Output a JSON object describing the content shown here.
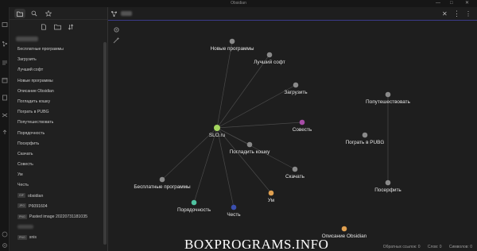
{
  "window": {
    "title": "Obsidian",
    "minimize_glyph": "—",
    "maximize_glyph": "□",
    "close_glyph": "✕"
  },
  "ribbon": {
    "icons": [
      "open-vault-icon",
      "graph-icon",
      "command-icon",
      "daily-note-icon",
      "template-icon",
      "random-note-icon",
      "publish-icon"
    ]
  },
  "sidebar": {
    "tabs": [
      "file-explorer-icon",
      "search-icon",
      "star-icon"
    ],
    "actions": [
      "new-note-icon",
      "new-folder-icon",
      "sort-icon"
    ],
    "files": [
      {
        "label": "Бесплатные программы"
      },
      {
        "label": "Загрузить"
      },
      {
        "label": "Лучший софт"
      },
      {
        "label": "Новые программы"
      },
      {
        "label": "Описание Obsidian"
      },
      {
        "label": "Погладить кошку"
      },
      {
        "label": "Пограть в PUBG"
      },
      {
        "label": "Попутешествовать"
      },
      {
        "label": "Порядочность"
      },
      {
        "label": "Посерфить"
      },
      {
        "label": "Скачать"
      },
      {
        "label": "Совесть"
      },
      {
        "label": "Ум"
      },
      {
        "label": "Честь"
      },
      {
        "label": "obsidian",
        "ext": "GIF"
      },
      {
        "label": "P6091604",
        "ext": "JPG"
      },
      {
        "label": "Pasted image 20220731181035",
        "ext": "PNG"
      },
      {
        "label": "",
        "blurred": true
      },
      {
        "label": "snis",
        "ext": "PNG"
      }
    ]
  },
  "tabbar": {
    "more_glyph": "⋮",
    "close_glyph": "✕"
  },
  "graph": {
    "nodes": [
      {
        "id": "slo",
        "label": "SLO.ru",
        "color": "#a4d65e"
      },
      {
        "id": "new",
        "label": "Новые программы",
        "color": "#8a8a8a"
      },
      {
        "id": "best",
        "label": "Лучший софт",
        "color": "#8a8a8a"
      },
      {
        "id": "load",
        "label": "Загрузить",
        "color": "#8a8a8a"
      },
      {
        "id": "conscience",
        "label": "Совесть",
        "color": "#a64ca6"
      },
      {
        "id": "cat",
        "label": "Погладить кошку",
        "color": "#8a8a8a"
      },
      {
        "id": "download",
        "label": "Скачать",
        "color": "#8a8a8a"
      },
      {
        "id": "free",
        "label": "Бесплатные программы",
        "color": "#8a8a8a"
      },
      {
        "id": "decency",
        "label": "Порядочность",
        "color": "#4fc3a1"
      },
      {
        "id": "honor",
        "label": "Честь",
        "color": "#3b4fae"
      },
      {
        "id": "mind",
        "label": "Ум",
        "color": "#e0a050"
      },
      {
        "id": "travel",
        "label": "Попутешествовать",
        "color": "#8a8a8a"
      },
      {
        "id": "pubg",
        "label": "Пограть в  PUBG",
        "color": "#8a8a8a"
      },
      {
        "id": "surf",
        "label": "Посерфить",
        "color": "#8a8a8a"
      },
      {
        "id": "obs",
        "label": "Описание Obsidian",
        "color": "#e0a050"
      }
    ],
    "edges": [
      [
        "slo",
        "new"
      ],
      [
        "slo",
        "best"
      ],
      [
        "slo",
        "load"
      ],
      [
        "slo",
        "conscience"
      ],
      [
        "slo",
        "cat"
      ],
      [
        "slo",
        "download"
      ],
      [
        "slo",
        "free"
      ],
      [
        "slo",
        "decency"
      ],
      [
        "slo",
        "honor"
      ],
      [
        "slo",
        "mind"
      ],
      [
        "travel",
        "surf"
      ]
    ]
  },
  "status": {
    "backlinks": "Обратных ссылок: 0",
    "words": "Слов: 0",
    "chars": "Символов: 0"
  },
  "watermark": "BOXPROGRAMS.INFO"
}
